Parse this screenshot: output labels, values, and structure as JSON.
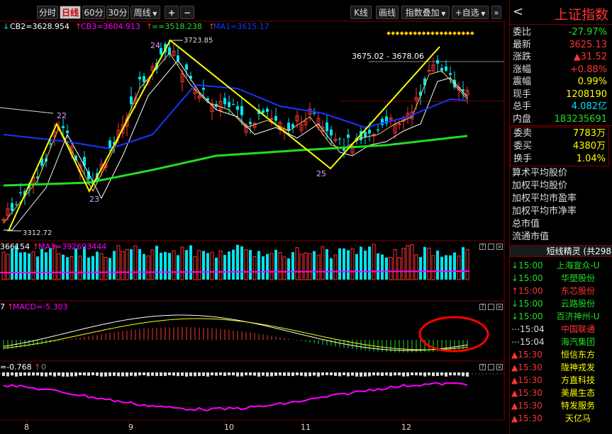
{
  "toolbar": {
    "tab_fenshi": "分时",
    "tab_rixian": "日线",
    "tab_60": "60分",
    "tab_30": "30分",
    "tab_zhouxian": "周线",
    "plus": "+",
    "minus": "−",
    "kxian": "K线",
    "huaxian": "画线",
    "zhishu_diejia": "指数叠加",
    "zixuan": "+自选"
  },
  "main": {
    "legend": {
      "cb2": "CB2=3628.954",
      "cb3": "CB3=3604.913",
      "inf": "∞=3518.238",
      "ma1": "MA1=3615.17"
    },
    "high_label": "3723.85",
    "low_label": "3312.72",
    "range_label": "3675.02 - 3678.06",
    "wave": {
      "w22": "22",
      "w23": "23",
      "w24": "24",
      "w25": "25"
    }
  },
  "volume": {
    "legend1": "366154",
    "ma3": "MA3=392693444"
  },
  "macd": {
    "legend0": "7",
    "value": "MACD=-5.303"
  },
  "ind3": {
    "value": "=-0.768",
    "extra": "0"
  },
  "months": [
    "8",
    "9",
    "10",
    "11",
    "12"
  ],
  "colors": {
    "up": "#ff3333",
    "down": "#00e5ee",
    "ma_yellow": "#ffff00",
    "ma_white": "#ffffff",
    "ma_blue": "#1a34ff",
    "ma_green": "#22dd22",
    "magenta": "#ff00ff",
    "grid": "#7a0000"
  },
  "right": {
    "title": "上证指数",
    "back": "<",
    "quotes": [
      {
        "k": "委比",
        "v": "-27.97%",
        "c": "#22dd22"
      },
      {
        "k": "最新",
        "v": "3625.13",
        "c": "#ff3333"
      },
      {
        "k": "涨跌",
        "v": "▲31.52",
        "c": "#ff3333"
      },
      {
        "k": "涨幅",
        "v": "+0.88%",
        "c": "#ff3333"
      },
      {
        "k": "震幅",
        "v": "0.99%",
        "c": "#ffff00"
      },
      {
        "k": "现手",
        "v": "1208190",
        "c": "#ffff00"
      },
      {
        "k": "总手",
        "v": "4.082亿",
        "c": "#00e5ee"
      },
      {
        "k": "内盘",
        "v": "183235691",
        "c": "#22dd22"
      }
    ],
    "quotes2": [
      {
        "k": "委卖",
        "v": "7783万",
        "c": "#ffff00"
      },
      {
        "k": "委买",
        "v": "4380万",
        "c": "#ffff00"
      },
      {
        "k": "换手",
        "v": "1.04%",
        "c": "#ffff00"
      }
    ],
    "metrics": [
      "算术平均股价",
      "加权平均股价",
      "加权平均市盈率",
      "加权平均市净率",
      "总市值",
      "流通市值"
    ],
    "sprite_title": "短线精灵 (共298",
    "news": [
      {
        "a": "↓",
        "t": "15:00",
        "n": "上海宣众-U",
        "c": "#22dd22"
      },
      {
        "a": "↓",
        "t": "15:00",
        "n": "华塑股份",
        "c": "#22dd22"
      },
      {
        "a": "↑",
        "t": "15:00",
        "n": "东芯股份",
        "c": "#ff3333"
      },
      {
        "a": "↓",
        "t": "15:00",
        "n": "云路股份",
        "c": "#22dd22"
      },
      {
        "a": "↓",
        "t": "15:00",
        "n": "百济神州-U",
        "c": "#22dd22"
      },
      {
        "a": "⋯",
        "t": "15:04",
        "n": "中国联通",
        "c": "#ff3333"
      },
      {
        "a": "⋯",
        "t": "15:04",
        "n": "海汽集团",
        "c": "#22dd22"
      },
      {
        "a": "▲",
        "t": "15:30",
        "n": "恒信东方",
        "c": "#ffff00"
      },
      {
        "a": "▲",
        "t": "15:30",
        "n": "陇神戎发",
        "c": "#ffff00"
      },
      {
        "a": "▲",
        "t": "15:30",
        "n": "方直科技",
        "c": "#ffff00"
      },
      {
        "a": "▲",
        "t": "15:30",
        "n": "美晨生态",
        "c": "#ffff00"
      },
      {
        "a": "▲",
        "t": "15:30",
        "n": "特发服务",
        "c": "#ffff00"
      },
      {
        "a": "▲",
        "t": "15:30",
        "n": "天亿马",
        "c": "#ffff00"
      }
    ]
  }
}
